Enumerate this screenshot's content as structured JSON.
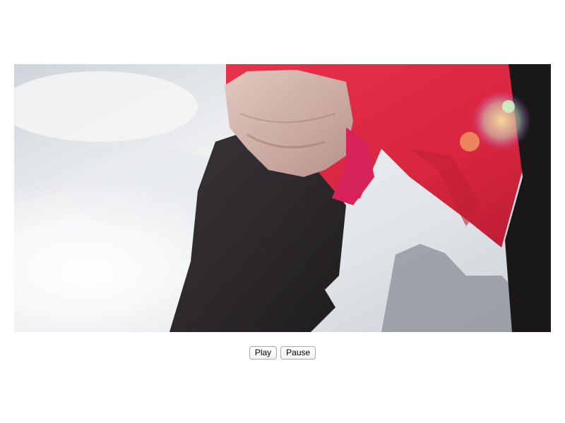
{
  "controls": {
    "play_label": "Play",
    "pause_label": "Pause"
  }
}
